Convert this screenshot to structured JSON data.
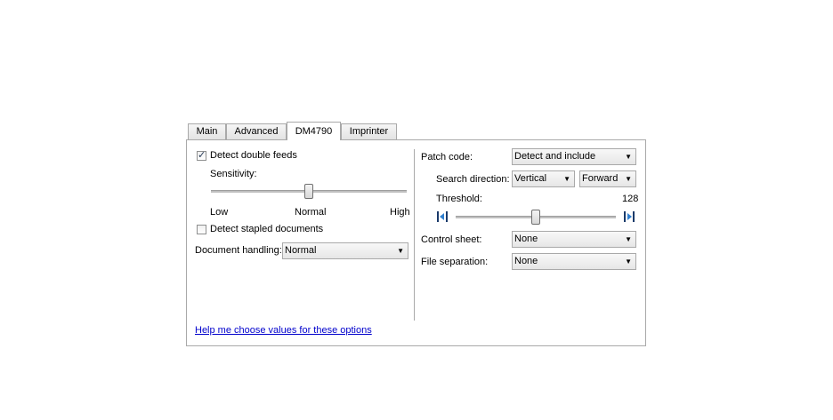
{
  "tabs": [
    {
      "label": "Main",
      "active": false
    },
    {
      "label": "Advanced",
      "active": false
    },
    {
      "label": "DM4790",
      "active": true
    },
    {
      "label": "Imprinter",
      "active": false
    }
  ],
  "left": {
    "detect_double_feeds": {
      "label": "Detect double feeds",
      "checked": true
    },
    "sensitivity": {
      "label": "Sensitivity:",
      "low": "Low",
      "normal": "Normal",
      "high": "High",
      "level": 0.5
    },
    "detect_stapled": {
      "label": "Detect stapled documents",
      "checked": false
    },
    "document_handling": {
      "label": "Document handling:",
      "value": "Normal"
    }
  },
  "right": {
    "patch_code": {
      "label": "Patch code:",
      "value": "Detect and include"
    },
    "search_direction": {
      "label": "Search direction:",
      "direction": "Vertical",
      "order": "Forward"
    },
    "threshold": {
      "label": "Threshold:",
      "value": "128",
      "level": 0.5
    },
    "control_sheet": {
      "label": "Control sheet:",
      "value": "None"
    },
    "file_separation": {
      "label": "File separation:",
      "value": "None"
    }
  },
  "help_link": "Help me choose values for these options"
}
